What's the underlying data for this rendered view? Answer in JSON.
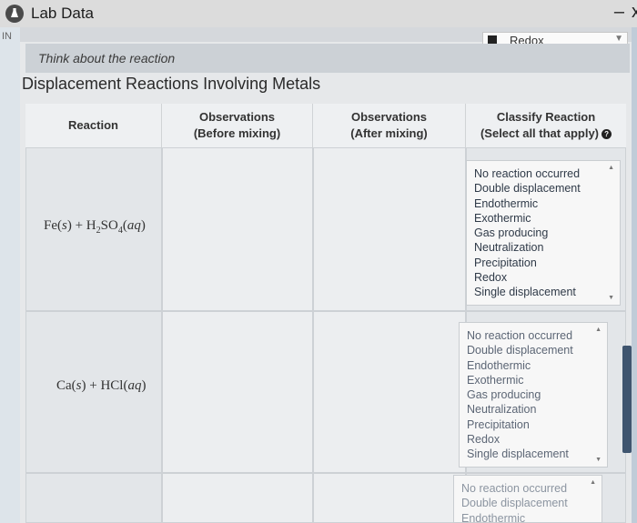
{
  "window": {
    "title": "Lab Data",
    "minimize_glyph": "–",
    "close_glyph": "x"
  },
  "left_tag": "IN",
  "header_select": {
    "value": "Redox"
  },
  "prompt": "Think about the reaction",
  "heading": "Displacement Reactions Involving Metals",
  "table": {
    "columns": [
      {
        "line1": "Reaction",
        "line2": ""
      },
      {
        "line1": "Observations",
        "line2": "(Before mixing)"
      },
      {
        "line1": "Observations",
        "line2": "(After mixing)"
      },
      {
        "line1": "Classify Reaction",
        "line2": "(Select all that apply)"
      }
    ],
    "rows": [
      {
        "reaction": "Fe(s) + H2SO4(aq)"
      },
      {
        "reaction": "Ca(s) + HCl(aq)"
      }
    ],
    "options": [
      "No reaction occurred",
      "Double displacement",
      "Endothermic",
      "Exothermic",
      "Gas producing",
      "Neutralization",
      "Precipitation",
      "Redox",
      "Single displacement"
    ],
    "third_row_options": [
      "No reaction occurred",
      "Double displacement",
      "Endothermic"
    ]
  },
  "icons": [
    "lab-flask-icon",
    "info-icon",
    "chevron-down-icon",
    "scroll-up-icon",
    "scroll-down-icon"
  ]
}
